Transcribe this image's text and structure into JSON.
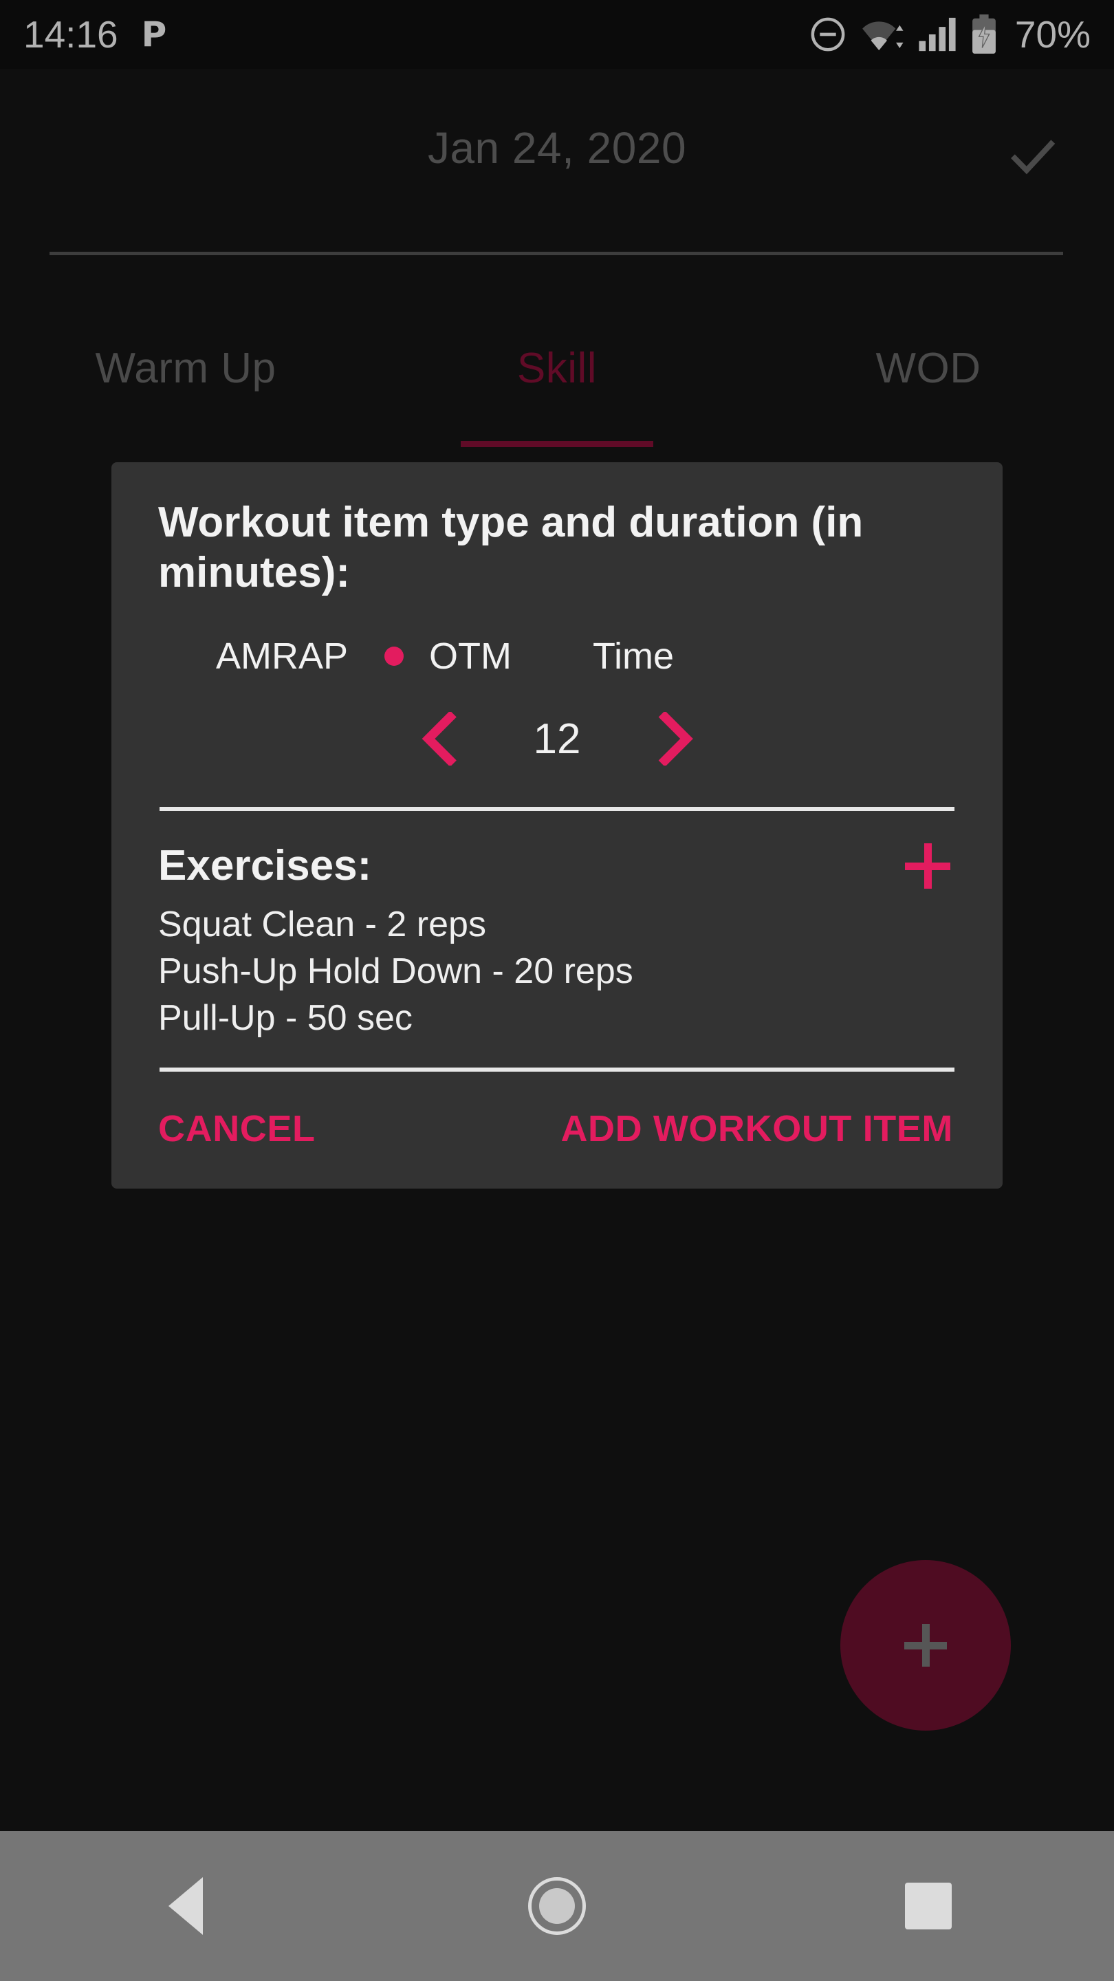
{
  "status_bar": {
    "time": "14:16",
    "app_icon": "P",
    "dnd_icon": "do-not-disturb-icon",
    "wifi_icon": "wifi-icon",
    "signal_icon": "cellular-signal-icon",
    "battery_icon": "battery-charging-icon",
    "battery_percent": "70%"
  },
  "app_bar": {
    "title": "Jan 24, 2020",
    "confirm_icon": "check-icon"
  },
  "tabs": [
    {
      "label": "Warm Up",
      "active": false
    },
    {
      "label": "Skill",
      "active": true
    },
    {
      "label": "WOD",
      "active": false
    }
  ],
  "fab": {
    "icon": "plus-icon",
    "color": "#711232"
  },
  "dialog": {
    "title": "Workout item type and duration (in minutes):",
    "type_options": [
      {
        "label": "AMRAP",
        "selected": false
      },
      {
        "label": "OTM",
        "selected": true
      },
      {
        "label": "Time",
        "selected": false
      }
    ],
    "stepper": {
      "decrement_icon": "chevron-left-icon",
      "value": "12",
      "increment_icon": "chevron-right-icon"
    },
    "exercises_heading": "Exercises:",
    "exercises_add_icon": "plus-icon",
    "exercises": [
      "Squat Clean - 2 reps",
      "Push-Up Hold Down - 20 reps",
      "Pull-Up - 50 sec"
    ],
    "cancel_label": "CANCEL",
    "confirm_label": "ADD WORKOUT ITEM"
  },
  "nav_bar": {
    "back_icon": "back-triangle-icon",
    "home_icon": "home-circle-icon",
    "recents_icon": "recents-square-icon"
  },
  "colors": {
    "accent": "#e31c5f",
    "accent_dim": "#8a1038",
    "background": "#161616",
    "dialog_surface": "#333333",
    "nav_bar": "#767676"
  }
}
